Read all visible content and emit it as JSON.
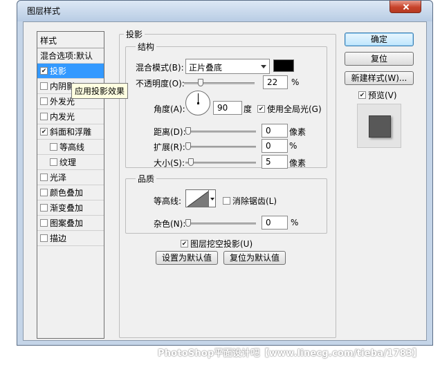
{
  "window": {
    "title": "图层样式"
  },
  "style_list": {
    "header": "样式",
    "items": [
      {
        "label": "混合选项:默认",
        "checkbox": false,
        "checked": false,
        "indent": false,
        "selected": false
      },
      {
        "label": "投影",
        "checkbox": true,
        "checked": true,
        "indent": false,
        "selected": true
      },
      {
        "label": "内阴影",
        "checkbox": true,
        "checked": false,
        "indent": false,
        "selected": false
      },
      {
        "label": "外发光",
        "checkbox": true,
        "checked": false,
        "indent": false,
        "selected": false
      },
      {
        "label": "内发光",
        "checkbox": true,
        "checked": false,
        "indent": false,
        "selected": false
      },
      {
        "label": "斜面和浮雕",
        "checkbox": true,
        "checked": true,
        "indent": false,
        "selected": false
      },
      {
        "label": "等高线",
        "checkbox": true,
        "checked": false,
        "indent": true,
        "selected": false
      },
      {
        "label": "纹理",
        "checkbox": true,
        "checked": false,
        "indent": true,
        "selected": false
      },
      {
        "label": "光泽",
        "checkbox": true,
        "checked": false,
        "indent": false,
        "selected": false
      },
      {
        "label": "颜色叠加",
        "checkbox": true,
        "checked": false,
        "indent": false,
        "selected": false
      },
      {
        "label": "渐变叠加",
        "checkbox": true,
        "checked": false,
        "indent": false,
        "selected": false
      },
      {
        "label": "图案叠加",
        "checkbox": true,
        "checked": false,
        "indent": false,
        "selected": false
      },
      {
        "label": "描边",
        "checkbox": true,
        "checked": false,
        "indent": false,
        "selected": false
      }
    ]
  },
  "tooltip": "应用投影效果",
  "drop_shadow": {
    "section_title": "投影",
    "structure": {
      "title": "结构",
      "blend_mode_label": "混合模式(B):",
      "blend_mode_value": "正片叠底",
      "shadow_color": "#000000",
      "opacity_label": "不透明度(O):",
      "opacity_value": "22",
      "opacity_unit": "%",
      "angle_label": "角度(A):",
      "angle_value": "90",
      "angle_unit": "度",
      "global_light_label": "使用全局光(G)",
      "global_light_checked": true,
      "distance_label": "距离(D):",
      "distance_value": "0",
      "distance_unit": "像素",
      "spread_label": "扩展(R):",
      "spread_value": "0",
      "spread_unit": "%",
      "size_label": "大小(S):",
      "size_value": "5",
      "size_unit": "像素"
    },
    "quality": {
      "title": "品质",
      "contour_label": "等高线:",
      "anti_alias_label": "消除锯齿(L)",
      "anti_alias_checked": false,
      "noise_label": "杂色(N):",
      "noise_value": "0",
      "noise_unit": "%"
    },
    "knockout_label": "图层挖空投影(U)",
    "knockout_checked": true,
    "make_default_label": "设置为默认值",
    "reset_default_label": "复位为默认值"
  },
  "buttons": {
    "ok": "确定",
    "reset": "复位",
    "new_style": "新建样式(W)...",
    "preview_label": "预览(V)",
    "preview_checked": true
  },
  "watermark": "PhotoShop平面设计吧【www.linecg.com/tieba/1783】"
}
